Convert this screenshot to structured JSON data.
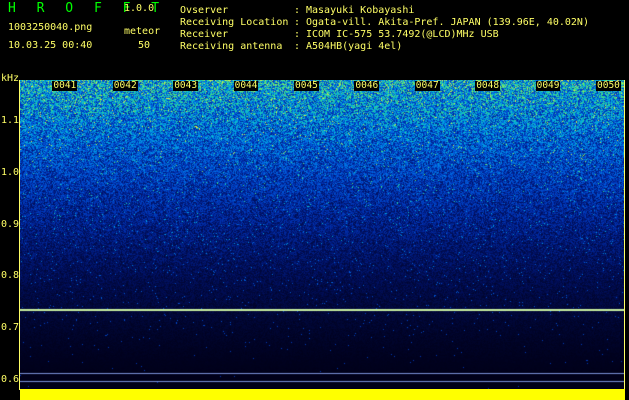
{
  "header": {
    "app_title": "H R O F F T",
    "version": "1.0.0",
    "filename": "1003250040.png",
    "timestamp": "10.03.25 00:40",
    "meteor_label": "meteor",
    "meteor_count": "50"
  },
  "info": [
    {
      "label": "Ovserver",
      "value": "Masayuki Kobayashi"
    },
    {
      "label": "Receiving Location",
      "value": "Ogata-vill. Akita-Pref. JAPAN (139.96E, 40.02N)"
    },
    {
      "label": "Receiver",
      "value": "ICOM IC-575 53.7492(@LCD)MHz USB"
    },
    {
      "label": "Receiving antenna",
      "value": "A504HB(yagi 4el)"
    }
  ],
  "colors": {
    "label_text": "#ffff66",
    "title_text": "#00ff00",
    "bottom_bar": "#ffff00",
    "background": "#000000"
  },
  "chart_data": {
    "type": "heatmap",
    "ylabel": "kHz",
    "yticks": [
      "1.1",
      "1.0",
      "0.9",
      "0.8",
      "0.7",
      "0.6"
    ],
    "ylim": [
      0.58,
      1.18
    ],
    "xticks": [
      "0041",
      "0042",
      "0043",
      "0044",
      "0045",
      "0046",
      "0047",
      "0048",
      "0049",
      "0050"
    ],
    "xlim": [
      "0040",
      "0050"
    ],
    "carrier_lines_khz": [
      0.737,
      0.612,
      0.598
    ],
    "colormap": [
      "#000018",
      "#001060",
      "#0030b0",
      "#0060e0",
      "#00b0e0",
      "#40e080",
      "#e0f040"
    ],
    "grid": false
  }
}
